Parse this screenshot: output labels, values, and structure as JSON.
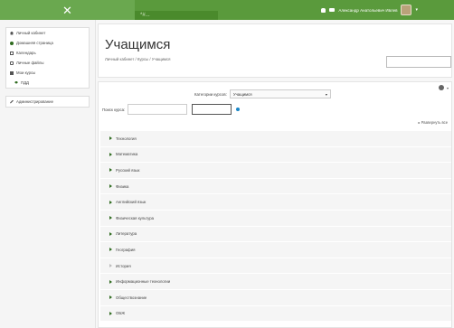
{
  "header": {
    "close_glyph": "✕",
    "brand_text": "*#...",
    "user_name": "Александр Анатольевич Ивлев",
    "caret": "▾"
  },
  "sidebar": {
    "items": [
      {
        "label": "Личный кабинет",
        "icon": "home-icon"
      },
      {
        "label": "Домашняя страница",
        "icon": "dashboard-icon"
      },
      {
        "label": "Календарь",
        "icon": "calendar-icon"
      },
      {
        "label": "Личные файлы",
        "icon": "file-icon"
      },
      {
        "label": "Мои курсы",
        "icon": "courses-icon"
      },
      {
        "label": "ПДД",
        "icon": "graduation-icon"
      },
      {
        "label": "Администрирование",
        "icon": "wrench-icon"
      }
    ]
  },
  "page": {
    "title": "Учащимся",
    "breadcrumb": "Личный кабинет  /  Курсы  /  Учащимся"
  },
  "content": {
    "category_label": "Категории курсов:",
    "category_selected": "Учащимся",
    "search_label": "Поиск курса:",
    "expand_all": "▸ Развернуть все",
    "categories": [
      {
        "label": "Технология",
        "expandable": true
      },
      {
        "label": "Математика",
        "expandable": true
      },
      {
        "label": "Русский язык",
        "expandable": true
      },
      {
        "label": "Физика",
        "expandable": true
      },
      {
        "label": "Английский язык",
        "expandable": true
      },
      {
        "label": "Физическая культура",
        "expandable": true
      },
      {
        "label": "Литература",
        "expandable": true
      },
      {
        "label": "География",
        "expandable": true
      },
      {
        "label": "История",
        "expandable": false
      },
      {
        "label": "Информационные технологии",
        "expandable": true
      },
      {
        "label": "Обществознание",
        "expandable": true
      },
      {
        "label": "ОБЖ",
        "expandable": true
      }
    ]
  },
  "colors": {
    "green": "#5a9a3c",
    "dark_green": "#2f6b1f"
  }
}
